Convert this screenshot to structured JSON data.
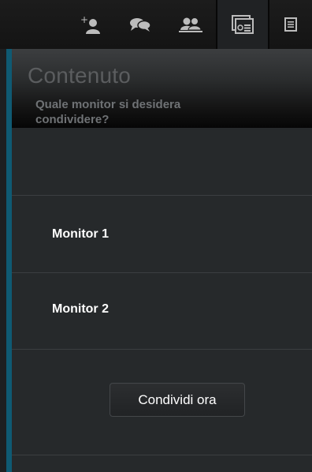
{
  "toolbar": {
    "buttons": [
      {
        "icon": "add-user-icon",
        "active": false
      },
      {
        "icon": "chat-icon",
        "active": false
      },
      {
        "icon": "participants-icon",
        "active": false
      },
      {
        "icon": "content-share-icon",
        "active": true
      },
      {
        "icon": "notes-icon",
        "active": false
      }
    ]
  },
  "panel": {
    "title": "Contenuto",
    "question": "Quale monitor si desidera condividere?",
    "monitors": [
      "Monitor 1",
      "Monitor 2"
    ],
    "share_button_label": "Condividi ora"
  },
  "colors": {
    "accent": "#0f5a73",
    "panel_bg": "#26292b",
    "toolbar_bg": "#1a1a1a"
  }
}
